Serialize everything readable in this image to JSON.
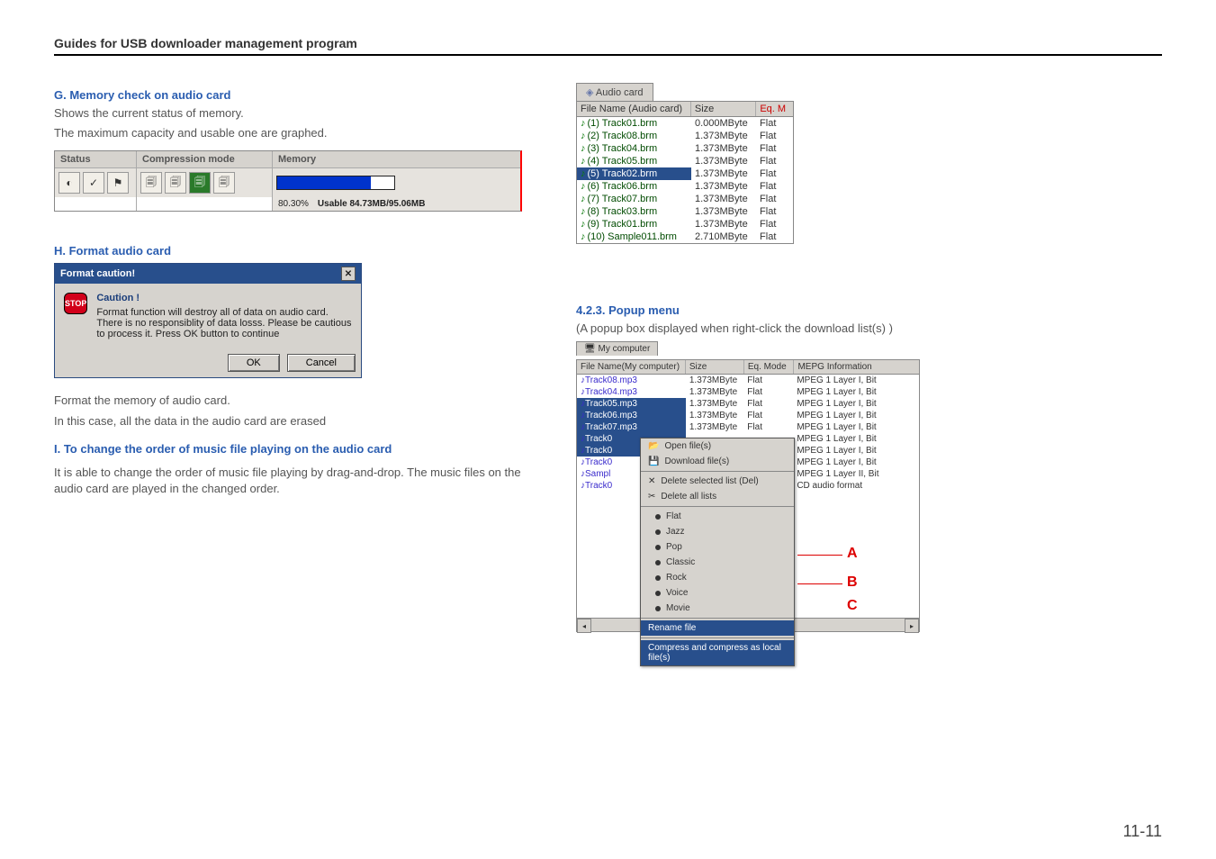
{
  "header": "Guides for USB downloader management program",
  "sectionG": {
    "title": "G. Memory check on audio card",
    "line1": "Shows the current status of memory.",
    "line2": "The maximum capacity and usable one are graphed."
  },
  "statusPanel": {
    "statusLabel": "Status",
    "compLabel": "Compression mode",
    "memLabel": "Memory",
    "percent": "80.30%",
    "usable": "Usable 84.73MB/95.06MB"
  },
  "sectionH": {
    "title": "H. Format audio card",
    "dialogTitle": "Format caution!",
    "cautionTitle": "Caution !",
    "cautionBody": "Format function will destroy all of data on audio card. There is no responsiblity of data losss. Please be cautious to process it. Press OK button to continue",
    "ok": "OK",
    "cancel": "Cancel",
    "after1": "Format the memory of audio card.",
    "after2": "In this case, all the data in the audio card are erased"
  },
  "sectionI": {
    "title": "I. To change the order of music file playing on the audio card",
    "body": "It is able to change the order of music file playing by drag-and-drop. The music files on the audio card are played in the changed order."
  },
  "audioCard": {
    "tab": "Audio card",
    "colFile": "File Name (Audio card)",
    "colSize": "Size",
    "colEq": "Eq. M",
    "rows": [
      {
        "name": "(1) Track01.brm",
        "size": "0.000MByte",
        "eq": "Flat",
        "sel": false
      },
      {
        "name": "(2) Track08.brm",
        "size": "1.373MByte",
        "eq": "Flat",
        "sel": false
      },
      {
        "name": "(3) Track04.brm",
        "size": "1.373MByte",
        "eq": "Flat",
        "sel": false
      },
      {
        "name": "(4) Track05.brm",
        "size": "1.373MByte",
        "eq": "Flat",
        "sel": false
      },
      {
        "name": "(5) Track02.brm",
        "size": "1.373MByte",
        "eq": "Flat",
        "sel": true
      },
      {
        "name": "(6) Track06.brm",
        "size": "1.373MByte",
        "eq": "Flat",
        "sel": false
      },
      {
        "name": "(7) Track07.brm",
        "size": "1.373MByte",
        "eq": "Flat",
        "sel": false
      },
      {
        "name": "(8) Track03.brm",
        "size": "1.373MByte",
        "eq": "Flat",
        "sel": false
      },
      {
        "name": "(9) Track01.brm",
        "size": "1.373MByte",
        "eq": "Flat",
        "sel": false
      },
      {
        "name": "(10) Sample011.brm",
        "size": "2.710MByte",
        "eq": "Flat",
        "sel": false
      }
    ]
  },
  "section423": {
    "title": "4.2.3. Popup menu",
    "sub": "(A popup box displayed when right-click the download list(s) )"
  },
  "popup": {
    "tab": "My computer",
    "headFile": "File Name(My computer)",
    "headSize": "Size",
    "headEq": "Eq. Mode",
    "headInfo": "MEPG Information",
    "rows": [
      {
        "name": "Track08.mp3",
        "size": "1.373MByte",
        "eq": "Flat",
        "info": "MPEG 1 Layer I, Bit",
        "sel": false
      },
      {
        "name": "Track04.mp3",
        "size": "1.373MByte",
        "eq": "Flat",
        "info": "MPEG 1 Layer I, Bit",
        "sel": false
      },
      {
        "name": "Track05.mp3",
        "size": "1.373MByte",
        "eq": "Flat",
        "info": "MPEG 1 Layer I, Bit",
        "sel": true
      },
      {
        "name": "Track06.mp3",
        "size": "1.373MByte",
        "eq": "Flat",
        "info": "MPEG 1 Layer I, Bit",
        "sel": true
      },
      {
        "name": "Track07.mp3",
        "size": "1.373MByte",
        "eq": "Flat",
        "info": "MPEG 1 Layer I, Bit",
        "sel": true
      },
      {
        "name": "Track0",
        "size": "",
        "eq": "",
        "info": "MPEG 1 Layer I, Bit",
        "sel": true
      },
      {
        "name": "Track0",
        "size": "",
        "eq": "",
        "info": "MPEG 1 Layer I, Bit",
        "sel": true
      },
      {
        "name": "Track0",
        "size": "",
        "eq": "",
        "info": "MPEG 1 Layer I, Bit",
        "sel": false
      },
      {
        "name": "Sampl",
        "size": "",
        "eq": "",
        "info": "MPEG 1 Layer II, Bit",
        "sel": false
      },
      {
        "name": "Track0",
        "size": "",
        "eq": "",
        "info": "CD audio format",
        "sel": false
      }
    ],
    "menu": {
      "open": "Open file(s)",
      "download": "Download file(s)",
      "deleteSel": "Delete selected list   (Del)",
      "deleteAll": "Delete all lists",
      "eqFlat": "Flat",
      "eqJazz": "Jazz",
      "eqPop": "Pop",
      "eqClassic": "Classic",
      "eqRock": "Rock",
      "eqVoice": "Voice",
      "eqMovie": "Movie",
      "rename": "Rename file",
      "compress": "Compress and compress as local file(s)"
    },
    "annoA": "A",
    "annoB": "B",
    "annoC": "C"
  },
  "pageNum": "11-11"
}
